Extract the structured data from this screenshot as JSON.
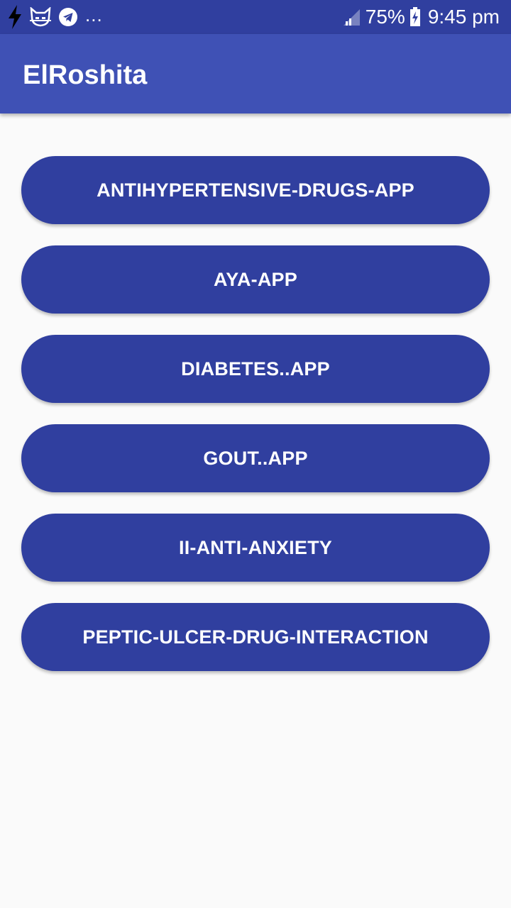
{
  "status_bar": {
    "left_icons": [
      "flash-icon",
      "cat-icon",
      "telegram-icon"
    ],
    "overflow_indicator": "...",
    "signal_icon": "signal-icon",
    "battery_percent": "75%",
    "battery_icon": "battery-charging-icon",
    "time": "9:45 pm"
  },
  "app_bar": {
    "title": "ElRoshita"
  },
  "menu": {
    "buttons": [
      {
        "label": "ANTIHYPERTENSIVE-DRUGS-APP"
      },
      {
        "label": "AYA-APP"
      },
      {
        "label": "DIABETES..APP"
      },
      {
        "label": "GOUT..APP"
      },
      {
        "label": "II-ANTI-ANXIETY"
      },
      {
        "label": "PEPTIC-ULCER-DRUG-INTERACTION"
      }
    ]
  },
  "colors": {
    "status_bar": "#303f9f",
    "app_bar": "#3f51b5",
    "button": "#303f9f",
    "background": "#fafafa",
    "text_on_primary": "#ffffff"
  }
}
